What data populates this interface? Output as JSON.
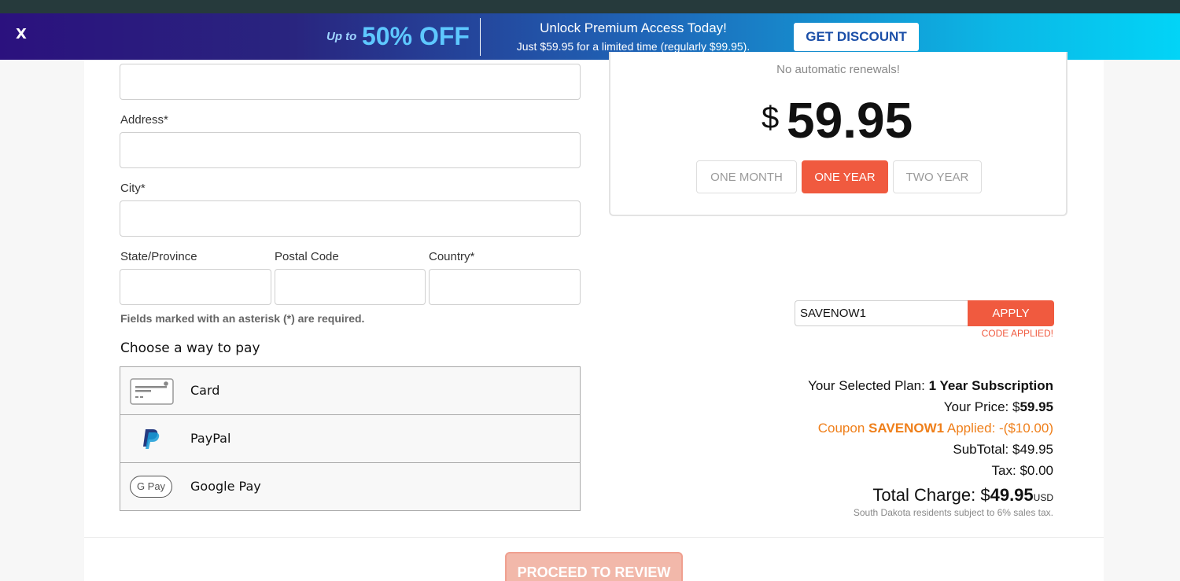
{
  "banner": {
    "close_label": "X",
    "promo_prefix": "Up to",
    "promo_discount": "50% OFF",
    "headline": "Unlock Premium Access Today!",
    "subline": "Just $59.95 for a limited time (regularly $99.95).",
    "button_label": "GET DISCOUNT"
  },
  "form": {
    "address_label": "Address*",
    "city_label": "City*",
    "state_label": "State/Province",
    "postal_label": "Postal Code",
    "country_label": "Country*",
    "required_note": "Fields marked with an asterisk (*) are required.",
    "pay_title": "Choose a way to pay",
    "pay_methods": [
      "Card",
      "PayPal",
      "Google Pay"
    ],
    "gpay_badge": "G Pay"
  },
  "plan": {
    "renewal_note": "No automatic renewals!",
    "currency_symbol": "$",
    "price": "59.95",
    "terms": [
      "ONE MONTH",
      "ONE YEAR",
      "TWO YEAR"
    ],
    "selected_term": "ONE YEAR"
  },
  "coupon": {
    "code": "SAVENOW1",
    "apply_label": "APPLY",
    "status": "CODE APPLIED!"
  },
  "summary": {
    "plan_label": "Your Selected Plan: ",
    "plan_value": "1 Year Subscription",
    "price_label": "Your Price: $",
    "price_value": "59.95",
    "coupon_prefix": "Coupon ",
    "coupon_code": "SAVENOW1",
    "coupon_suffix": " Applied: -($10.00)",
    "subtotal": "SubTotal: $49.95",
    "tax": "Tax: $0.00",
    "total_label": "Total Charge: $",
    "total_value": "49.95",
    "total_currency": "USD",
    "tax_note": "South Dakota residents subject to 6% sales tax."
  },
  "proceed_label": "PROCEED TO REVIEW",
  "colors": {
    "accent": "#f05a3f",
    "coupon_text": "#ef7f1a",
    "banner_start": "#2b117e",
    "banner_end": "#02d4f7"
  }
}
